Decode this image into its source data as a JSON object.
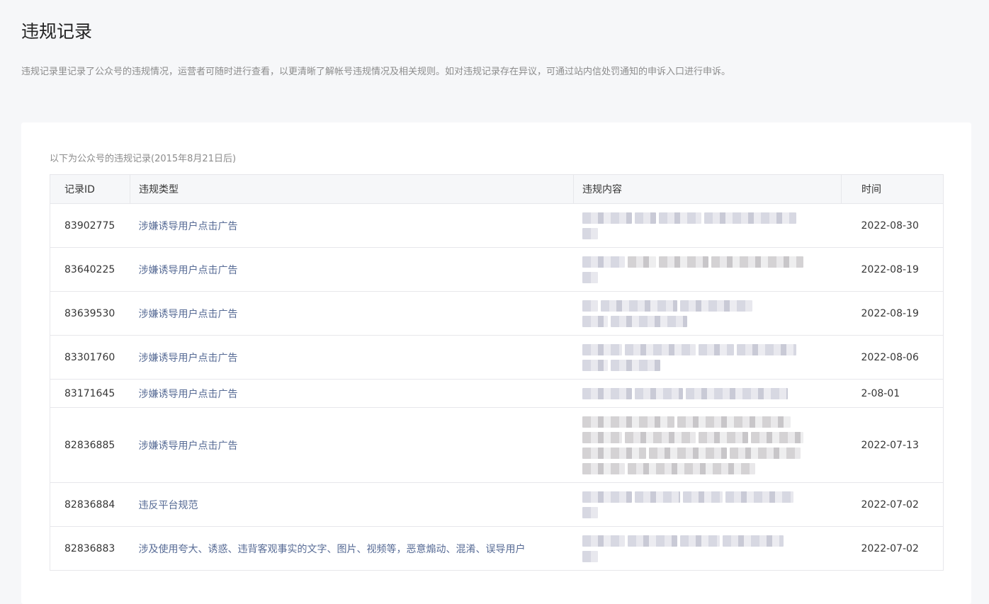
{
  "page": {
    "title": "违规记录",
    "description": "违规记录里记录了公众号的违规情况，运营者可随时进行查看，以更清晰了解帐号违规情况及相关规则。如对违规记录存在异议，可通过站内信处罚通知的申诉入口进行申诉。"
  },
  "table": {
    "caption": "以下为公众号的违规记录(2015年8月21日后)",
    "columns": [
      "记录ID",
      "违规类型",
      "违规内容",
      "时间"
    ],
    "rows": [
      {
        "id": "83902775",
        "type": "涉嫌诱导用户点击广告",
        "content": "",
        "date": "2022-08-30"
      },
      {
        "id": "83640225",
        "type": "涉嫌诱导用户点击广告",
        "content": "",
        "date": "2022-08-19"
      },
      {
        "id": "83639530",
        "type": "涉嫌诱导用户点击广告",
        "content": "",
        "date": "2022-08-19"
      },
      {
        "id": "83301760",
        "type": "涉嫌诱导用户点击广告",
        "content": "",
        "date": "2022-08-06"
      },
      {
        "id": "83171645",
        "type": "涉嫌诱导用户点击广告",
        "content": "",
        "date": "2-08-01"
      },
      {
        "id": "82836885",
        "type": "涉嫌诱导用户点击广告",
        "content": "",
        "date": "2022-07-13"
      },
      {
        "id": "82836884",
        "type": "违反平台规范",
        "content": "",
        "date": "2022-07-02"
      },
      {
        "id": "82836883",
        "type": "涉及使用夸大、诱惑、违背客观事实的文字、图片、视频等，恶意煽动、混淆、误导用户",
        "content": "",
        "date": "2022-07-02"
      }
    ]
  },
  "colors": {
    "page_bg": "#f6f7f9",
    "card_bg": "#ffffff",
    "link": "#576b95",
    "border": "#e7e7eb"
  }
}
